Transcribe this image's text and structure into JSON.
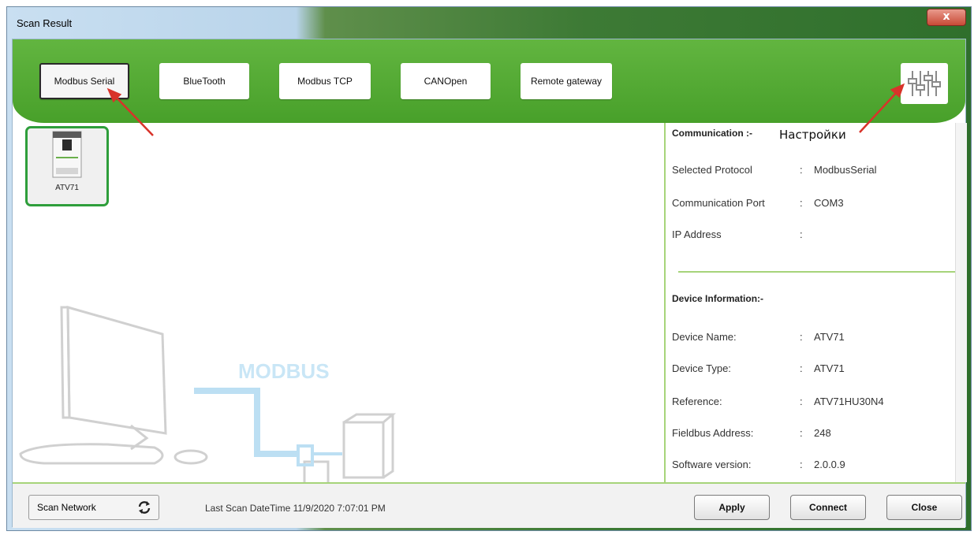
{
  "window": {
    "title": "Scan Result",
    "close_glyph": "x"
  },
  "ribbon": {
    "protocols": [
      {
        "label": "Modbus Serial",
        "selected": true
      },
      {
        "label": "BlueTooth",
        "selected": false
      },
      {
        "label": "Modbus TCP",
        "selected": false
      },
      {
        "label": "CANOpen",
        "selected": false
      },
      {
        "label": "Remote gateway",
        "selected": false
      }
    ],
    "settings_icon": "sliders-icon"
  },
  "annotation": {
    "settings_label": "Настройки"
  },
  "devices": [
    {
      "name": "ATV71"
    }
  ],
  "illustration": {
    "text": "MODBUS"
  },
  "communication": {
    "heading": "Communication :-",
    "rows": [
      {
        "label": "Selected Protocol",
        "value": "ModbusSerial"
      },
      {
        "label": "Communication Port",
        "value": "COM3"
      },
      {
        "label": "IP Address",
        "value": ""
      }
    ]
  },
  "device_info": {
    "heading": "Device Information:-",
    "rows": [
      {
        "label": "Device Name:",
        "value": "ATV71"
      },
      {
        "label": "Device Type:",
        "value": "ATV71"
      },
      {
        "label": "Reference:",
        "value": "ATV71HU30N4"
      },
      {
        "label": "Fieldbus Address:",
        "value": "248"
      },
      {
        "label": "Software version:",
        "value": "2.0.0.9"
      }
    ]
  },
  "footer": {
    "scan_button": "Scan Network",
    "last_scan": "Last Scan DateTime 11/9/2020 7:07:01 PM",
    "apply": "Apply",
    "connect": "Connect",
    "close": "Close"
  },
  "colors": {
    "ribbon_green": "#4caa2e",
    "accent_green": "#a6d47a",
    "tile_border": "#2e9e3b",
    "annotation_arrow": "#d8332a"
  }
}
